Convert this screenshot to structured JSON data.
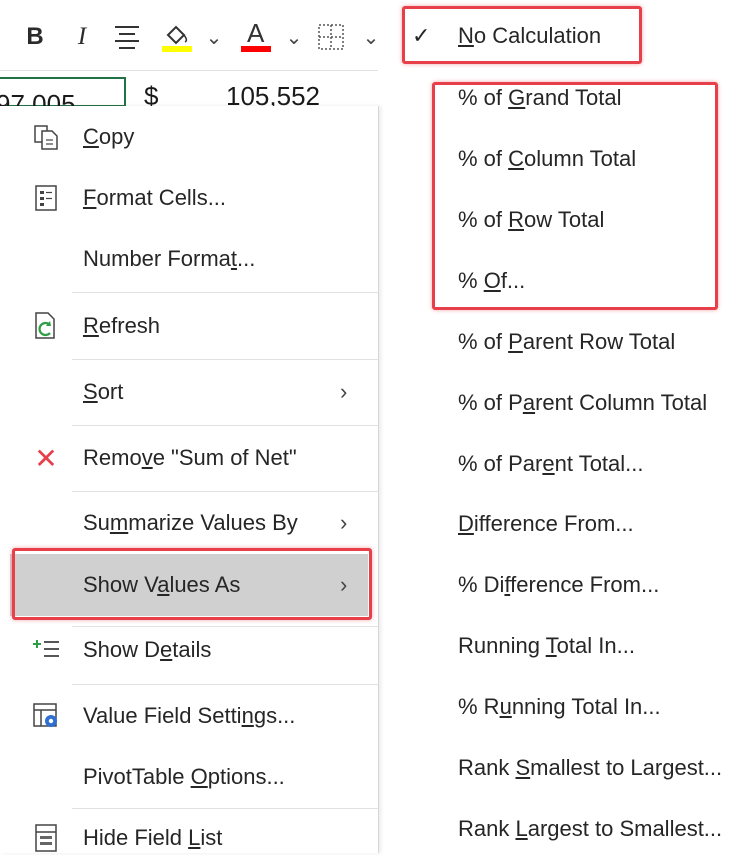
{
  "toolbar": {
    "bold": "B",
    "italic": "I",
    "font_color_glyph": "A",
    "icons": [
      "bold-icon",
      "italic-icon",
      "align-center-icon",
      "fill-color-icon",
      "dropdown-arrow-icon",
      "font-color-icon",
      "borders-icon"
    ],
    "fill_color": "#ffff00",
    "font_color": "#ff0000",
    "arrow_glyph": "⌄"
  },
  "sheet": {
    "cell_left": "97,005",
    "currency": "$",
    "cell_right": "105,552"
  },
  "context_menu": {
    "items": [
      {
        "id": "copy",
        "pre": "",
        "u": "C",
        "post": "opy",
        "icon": "copy-icon"
      },
      {
        "id": "format-cells",
        "pre": "",
        "u": "F",
        "post": "ormat Cells...",
        "icon": "format-cells-icon"
      },
      {
        "id": "number-format",
        "pre": "Number Forma",
        "u": "t",
        "post": "...",
        "icon": ""
      },
      {
        "id": "refresh",
        "pre": "",
        "u": "R",
        "post": "efresh",
        "icon": "refresh-icon"
      },
      {
        "id": "sort",
        "pre": "",
        "u": "S",
        "post": "ort",
        "icon": "",
        "submenu": true
      },
      {
        "id": "remove",
        "pre": "Remo",
        "u": "v",
        "post": "e \"Sum of Net\"",
        "icon": "remove-icon"
      },
      {
        "id": "summarize-values-by",
        "pre": "Su",
        "u": "m",
        "post": "marize Values By",
        "icon": "",
        "submenu": true
      },
      {
        "id": "show-values-as",
        "pre": "Show V",
        "u": "a",
        "post": "lues As",
        "icon": "",
        "submenu": true,
        "active": true
      },
      {
        "id": "show-details",
        "pre": "Show D",
        "u": "e",
        "post": "tails",
        "icon": "show-details-icon"
      },
      {
        "id": "value-field-settings",
        "pre": "Value Field Setti",
        "u": "n",
        "post": "gs...",
        "icon": "value-field-settings-icon"
      },
      {
        "id": "pivottable-options",
        "pre": "PivotTable ",
        "u": "O",
        "post": "ptions...",
        "icon": ""
      },
      {
        "id": "hide-field-list",
        "pre": "Hide Field ",
        "u": "L",
        "post": "ist",
        "icon": "field-list-icon"
      }
    ],
    "chevron": "›",
    "remove_glyph": "✕",
    "hover_color": "#d0d0d0"
  },
  "submenu": {
    "check_glyph": "✓",
    "items": [
      {
        "id": "no-calculation",
        "pre": "",
        "u": "N",
        "post": "o Calculation",
        "checked": true
      },
      {
        "id": "pct-grand-total",
        "pre": "% of ",
        "u": "G",
        "post": "rand Total"
      },
      {
        "id": "pct-column-total",
        "pre": "% of ",
        "u": "C",
        "post": "olumn Total"
      },
      {
        "id": "pct-row-total",
        "pre": "% of ",
        "u": "R",
        "post": "ow Total"
      },
      {
        "id": "pct-of",
        "pre": "% ",
        "u": "O",
        "post": "f..."
      },
      {
        "id": "pct-parent-row-total",
        "pre": "% of ",
        "u": "P",
        "post": "arent Row Total"
      },
      {
        "id": "pct-parent-column-total",
        "pre": "% of P",
        "u": "a",
        "post": "rent Column Total"
      },
      {
        "id": "pct-parent-total",
        "pre": "% of Par",
        "u": "e",
        "post": "nt Total..."
      },
      {
        "id": "difference-from",
        "pre": "",
        "u": "D",
        "post": "ifference From..."
      },
      {
        "id": "pct-difference-from",
        "pre": "% Di",
        "u": "f",
        "post": "ference From..."
      },
      {
        "id": "running-total-in",
        "pre": "Running ",
        "u": "T",
        "post": "otal In..."
      },
      {
        "id": "pct-running-total-in",
        "pre": "% R",
        "u": "u",
        "post": "nning Total In..."
      },
      {
        "id": "rank-smallest-to-largest",
        "pre": "Rank ",
        "u": "S",
        "post": "mallest to Largest..."
      },
      {
        "id": "rank-largest-to-smallest",
        "pre": "Rank ",
        "u": "L",
        "post": "argest to Smallest..."
      }
    ]
  },
  "annotation_color": "#e8404a"
}
